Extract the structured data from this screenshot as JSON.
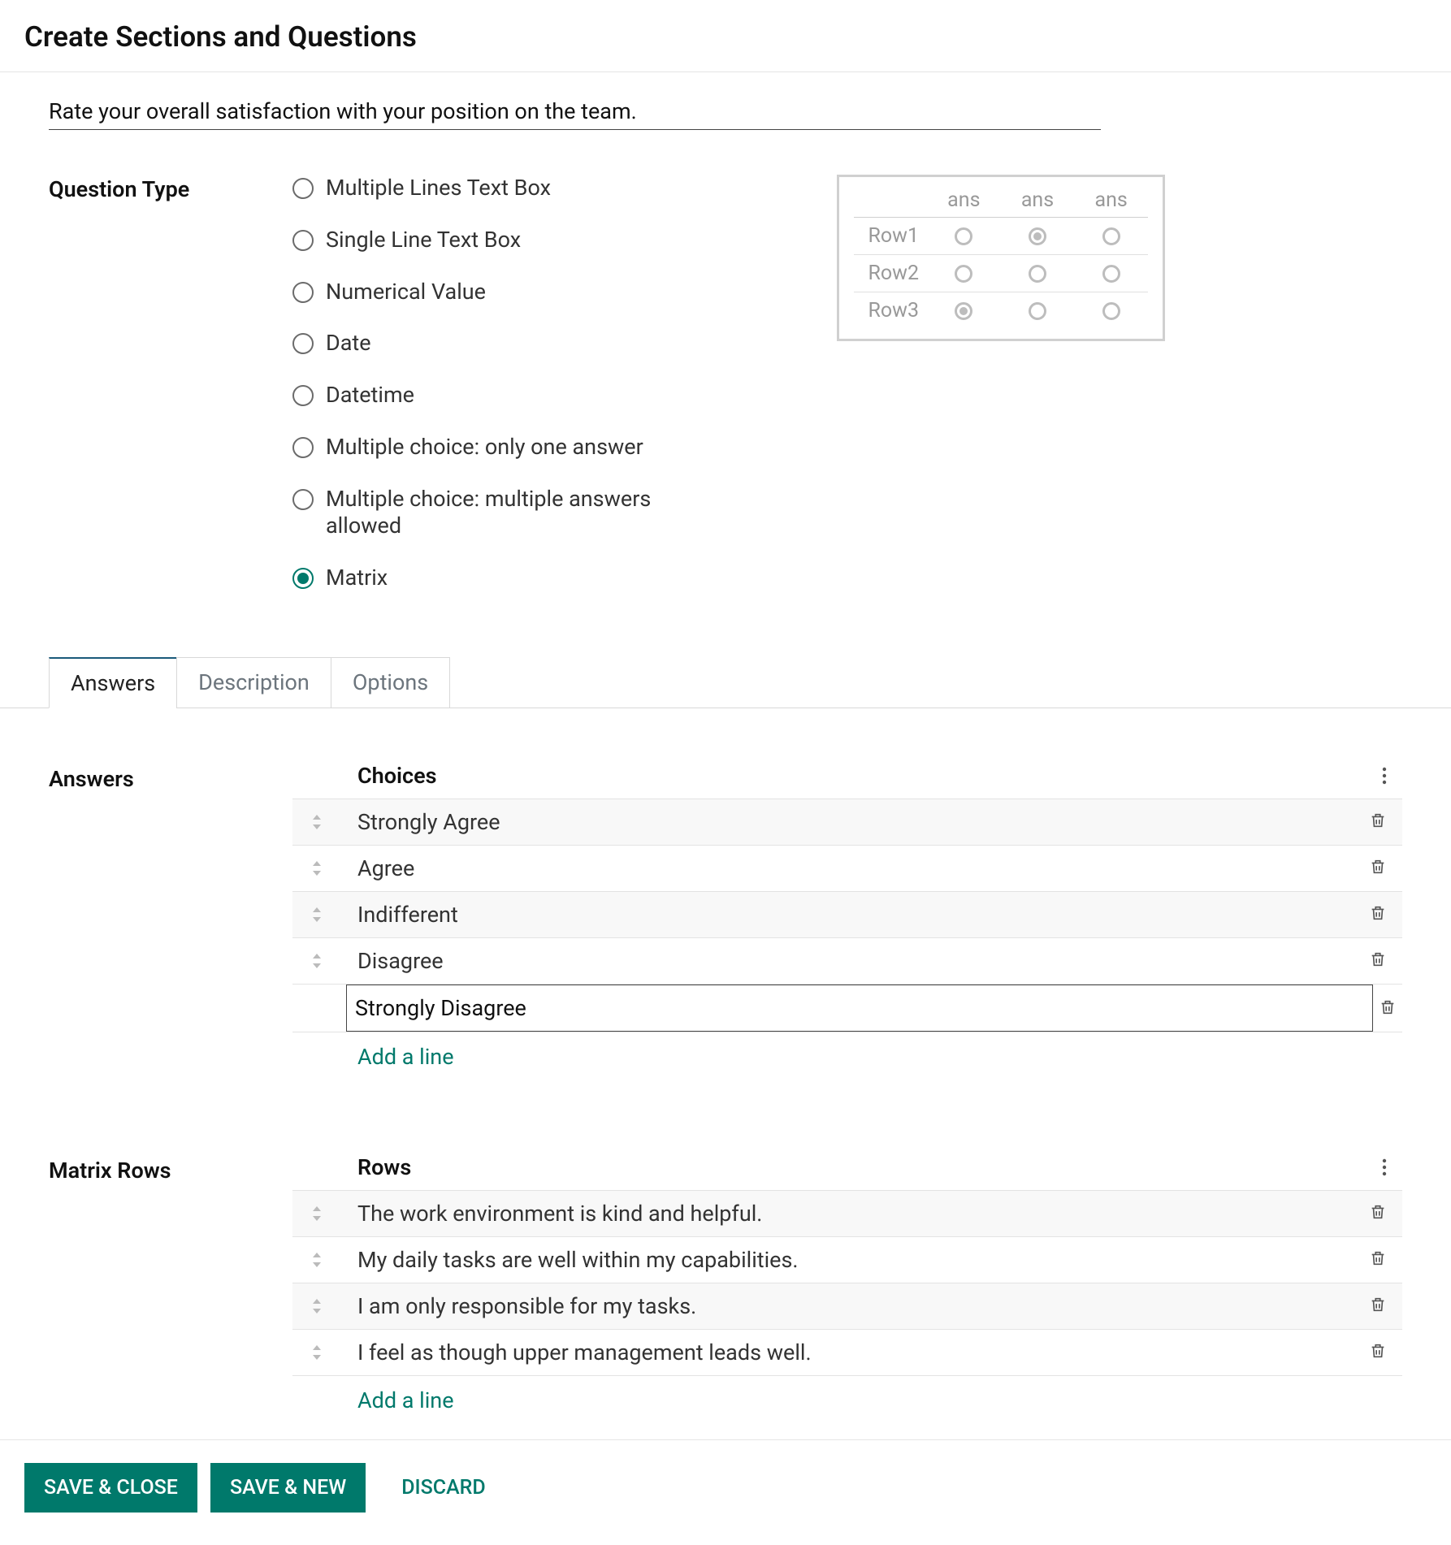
{
  "title": "Create Sections and Questions",
  "question_text": "Rate your overall satisfaction with your position on the team.",
  "question_type": {
    "label": "Question Type",
    "options": [
      {
        "label": "Multiple Lines Text Box"
      },
      {
        "label": "Single Line Text Box"
      },
      {
        "label": "Numerical Value"
      },
      {
        "label": "Date"
      },
      {
        "label": "Datetime"
      },
      {
        "label": "Multiple choice: only one answer"
      },
      {
        "label": "Multiple choice: multiple answers allowed"
      },
      {
        "label": "Matrix"
      }
    ],
    "selected_index": 7
  },
  "matrix_preview": {
    "cols": [
      "ans",
      "ans",
      "ans"
    ],
    "rows": [
      "Row1",
      "Row2",
      "Row3"
    ],
    "filled": [
      [
        false,
        true,
        false
      ],
      [
        false,
        false,
        false
      ],
      [
        true,
        false,
        false
      ]
    ]
  },
  "tabs": {
    "items": [
      {
        "label": "Answers"
      },
      {
        "label": "Description"
      },
      {
        "label": "Options"
      }
    ],
    "active_index": 0
  },
  "answers": {
    "section_label": "Answers",
    "header": "Choices",
    "items": [
      {
        "label": "Strongly Agree"
      },
      {
        "label": "Agree"
      },
      {
        "label": "Indifferent"
      },
      {
        "label": "Disagree"
      }
    ],
    "editing_value": "Strongly Disagree",
    "add_line": "Add a line"
  },
  "matrix_rows": {
    "section_label": "Matrix Rows",
    "header": "Rows",
    "items": [
      {
        "label": "The work environment is kind and helpful."
      },
      {
        "label": "My daily tasks are well within my capabilities."
      },
      {
        "label": "I am only responsible for my tasks."
      },
      {
        "label": "I feel as though upper management leads well."
      }
    ],
    "add_line": "Add a line"
  },
  "footer": {
    "save_close": "SAVE & CLOSE",
    "save_new": "SAVE & NEW",
    "discard": "DISCARD"
  }
}
